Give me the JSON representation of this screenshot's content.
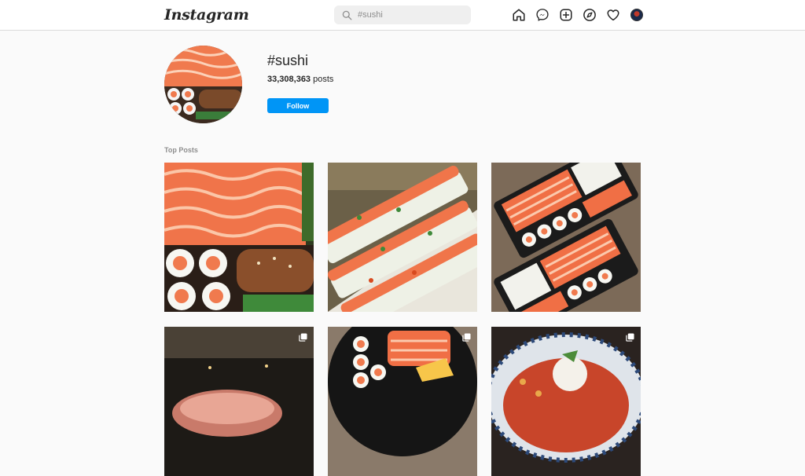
{
  "app": {
    "logo": "Instagram"
  },
  "search": {
    "value": "#sushi"
  },
  "nav": {
    "icons": [
      "home-icon",
      "messenger-icon",
      "new-post-icon",
      "explore-icon",
      "activity-heart-icon",
      "profile-avatar"
    ]
  },
  "header": {
    "hashtag": "#sushi",
    "post_count": "33,308,363",
    "posts_label": "posts",
    "follow_label": "Follow"
  },
  "section": {
    "title": "Top Posts"
  },
  "colors": {
    "accent": "#0095f6",
    "background": "#fafafa",
    "border": "#dbdbdb"
  },
  "posts": [
    {
      "subject": "salmon sashimi with rolls",
      "multi": false
    },
    {
      "subject": "sushi rolls platter",
      "multi": false
    },
    {
      "subject": "salmon sashimi boxes",
      "multi": false
    },
    {
      "subject": "grilled meat",
      "multi": true
    },
    {
      "subject": "sushi platter",
      "multi": true
    },
    {
      "subject": "poke bowl",
      "multi": true
    }
  ]
}
